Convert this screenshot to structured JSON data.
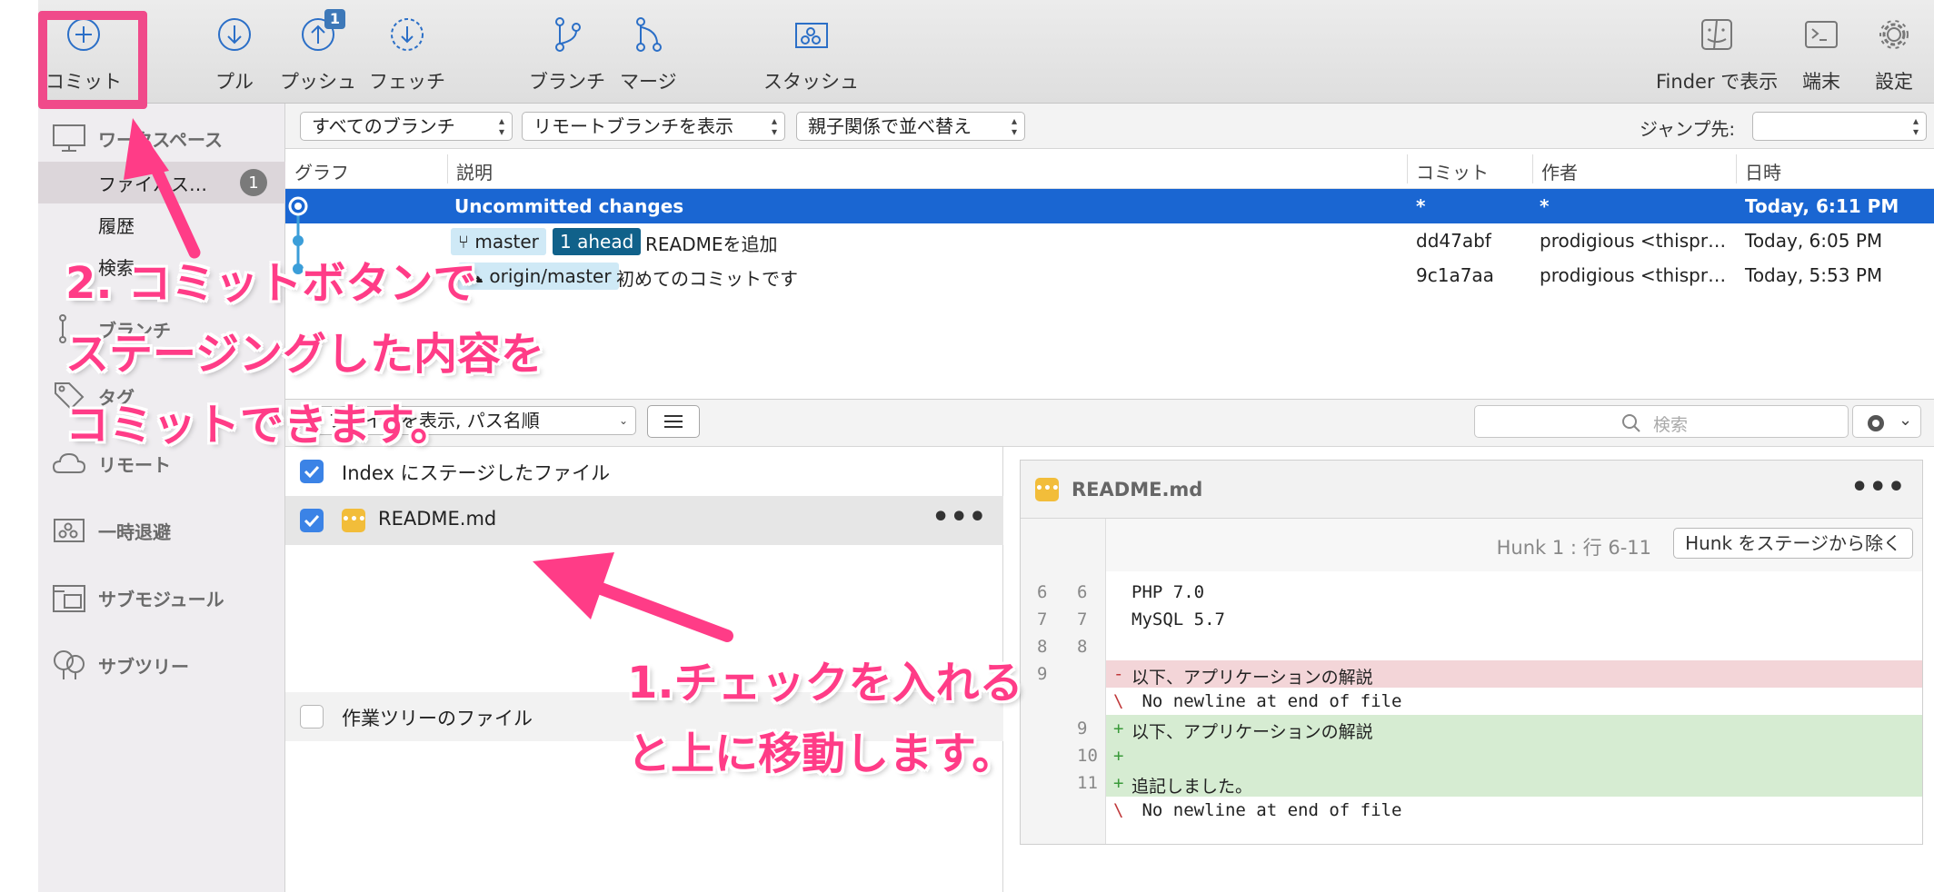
{
  "toolbar": {
    "commit_label": "コミット",
    "pull_label": "プル",
    "push_label": "プッシュ",
    "push_badge": "1",
    "fetch_label": "フェッチ",
    "branch_label": "ブランチ",
    "merge_label": "マージ",
    "stash_label": "スタッシュ",
    "finder_label": "Finder で表示",
    "terminal_label": "端末",
    "settings_label": "設定"
  },
  "sidebar": {
    "workspace_label": "ワークスペース",
    "file_status_label": "ファイルス…",
    "file_status_count": "1",
    "history_label": "履歴",
    "search_label": "検索",
    "branches_label": "ブランチ",
    "tags_label": "タグ",
    "remotes_label": "リモート",
    "stashes_label": "一時退避",
    "submodules_label": "サブモジュール",
    "subtrees_label": "サブツリー"
  },
  "filterbar": {
    "branches_select": "すべてのブランチ",
    "remote_select": "リモートブランチを表示",
    "sort_select": "親子関係で並べ替え",
    "jump_label": "ジャンプ先:",
    "jump_value": ""
  },
  "commit_list": {
    "headers": {
      "graph": "グラフ",
      "description": "説明",
      "commit": "コミット",
      "author": "作者",
      "date": "日時"
    },
    "rows": [
      {
        "description": "Uncommitted changes",
        "commit": "*",
        "author": "*",
        "date": "Today, 6:11 PM"
      },
      {
        "branch": "master",
        "ahead": "1 ahead",
        "description": "READMEを追加",
        "commit": "dd47abf",
        "author": "prodigious <thispr…",
        "date": "Today, 6:05 PM"
      },
      {
        "branch": "origin/master",
        "description": "初めてのコミットです",
        "commit": "9c1a7aa",
        "author": "prodigious <thispr…",
        "date": "Today, 5:53 PM"
      }
    ]
  },
  "bar2": {
    "view_select": "ファイルを表示, パス名順",
    "search_placeholder": "検索"
  },
  "files": {
    "staged_header": "Index にステージしたファイル",
    "staged_file": "README.md",
    "unstaged_header": "作業ツリーのファイル",
    "more": "•••"
  },
  "diff": {
    "filename": "README.md",
    "hunk_label": "Hunk 1 : 行 6-11",
    "hunk_button": "Hunk をステージから除く",
    "more": "•••",
    "lines": [
      {
        "old": "6",
        "new": "6",
        "sign": "",
        "code": "PHP 7.0"
      },
      {
        "old": "7",
        "new": "7",
        "sign": "",
        "code": "MySQL 5.7"
      },
      {
        "old": "8",
        "new": "8",
        "sign": "",
        "code": ""
      },
      {
        "old": "9",
        "new": "",
        "sign": "-",
        "code": "以下、アプリケーションの解説"
      },
      {
        "old": "",
        "new": "",
        "sign": "\\",
        "code": " No newline at end of file"
      },
      {
        "old": "",
        "new": "9",
        "sign": "+",
        "code": "以下、アプリケーションの解説"
      },
      {
        "old": "",
        "new": "10",
        "sign": "+",
        "code": ""
      },
      {
        "old": "",
        "new": "11",
        "sign": "+",
        "code": "追記しました。"
      },
      {
        "old": "",
        "new": "",
        "sign": "\\",
        "code": " No newline at end of file"
      }
    ]
  },
  "annotations": {
    "note2_line1": "2. コミットボタンで",
    "note2_line2": "ステージングした内容を",
    "note2_line3": "コミットできます。",
    "note1_line1": "1.チェックを入れる",
    "note1_line2": "と上に移動します。",
    "highlight_color": "#f04a8a",
    "text_color": "#ff3c87"
  },
  "colors": {
    "selection": "#1a66d2",
    "ahead_tag": "#10618a",
    "branch_tag": "#cfe9f6",
    "checkbox": "#3b83e6",
    "modified_icon": "#f2bd3a",
    "diff_deleted": "#f3d5d8",
    "diff_added": "#d6ecd2"
  }
}
